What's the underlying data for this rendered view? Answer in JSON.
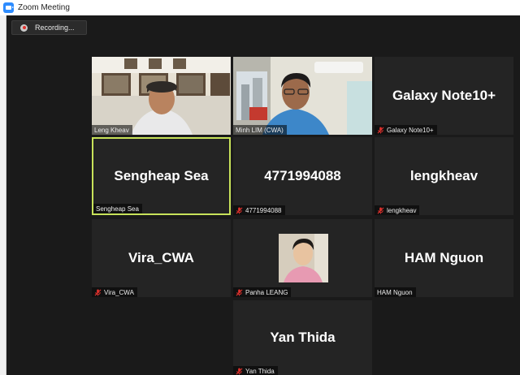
{
  "window": {
    "title": "Zoom Meeting",
    "icon": "zoom-camera-icon"
  },
  "recording": {
    "label": "Recording...",
    "icon": "recording-dot-icon"
  },
  "colors": {
    "stage": "#1a1a1a",
    "tile": "#242424",
    "active_border": "#c8e35a",
    "muted": "#e0312d"
  },
  "participants": [
    {
      "display": "",
      "label": "Leng Kheav",
      "video": true,
      "muted": false,
      "active": false
    },
    {
      "display": "",
      "label": "Minh LIM (CWA)",
      "video": true,
      "muted": false,
      "active": false
    },
    {
      "display": "Galaxy Note10+",
      "label": "Galaxy Note10+",
      "video": false,
      "muted": true,
      "active": false
    },
    {
      "display": "Sengheap Sea",
      "label": "Sengheap Sea",
      "video": false,
      "muted": false,
      "active": true
    },
    {
      "display": "4771994088",
      "label": "4771994088",
      "video": false,
      "muted": true,
      "active": false
    },
    {
      "display": "lengkheav",
      "label": "lengkheav",
      "video": false,
      "muted": true,
      "active": false
    },
    {
      "display": "Vira_CWA",
      "label": "Vira_CWA",
      "video": false,
      "muted": true,
      "active": false
    },
    {
      "display": "",
      "label": "Panha LEANG",
      "video": false,
      "muted": true,
      "active": false
    },
    {
      "display": "HAM Nguon",
      "label": "HAM Nguon",
      "video": false,
      "muted": false,
      "active": false
    },
    {
      "display": "Yan Thida",
      "label": "Yan Thida",
      "video": false,
      "muted": true,
      "active": false
    }
  ]
}
